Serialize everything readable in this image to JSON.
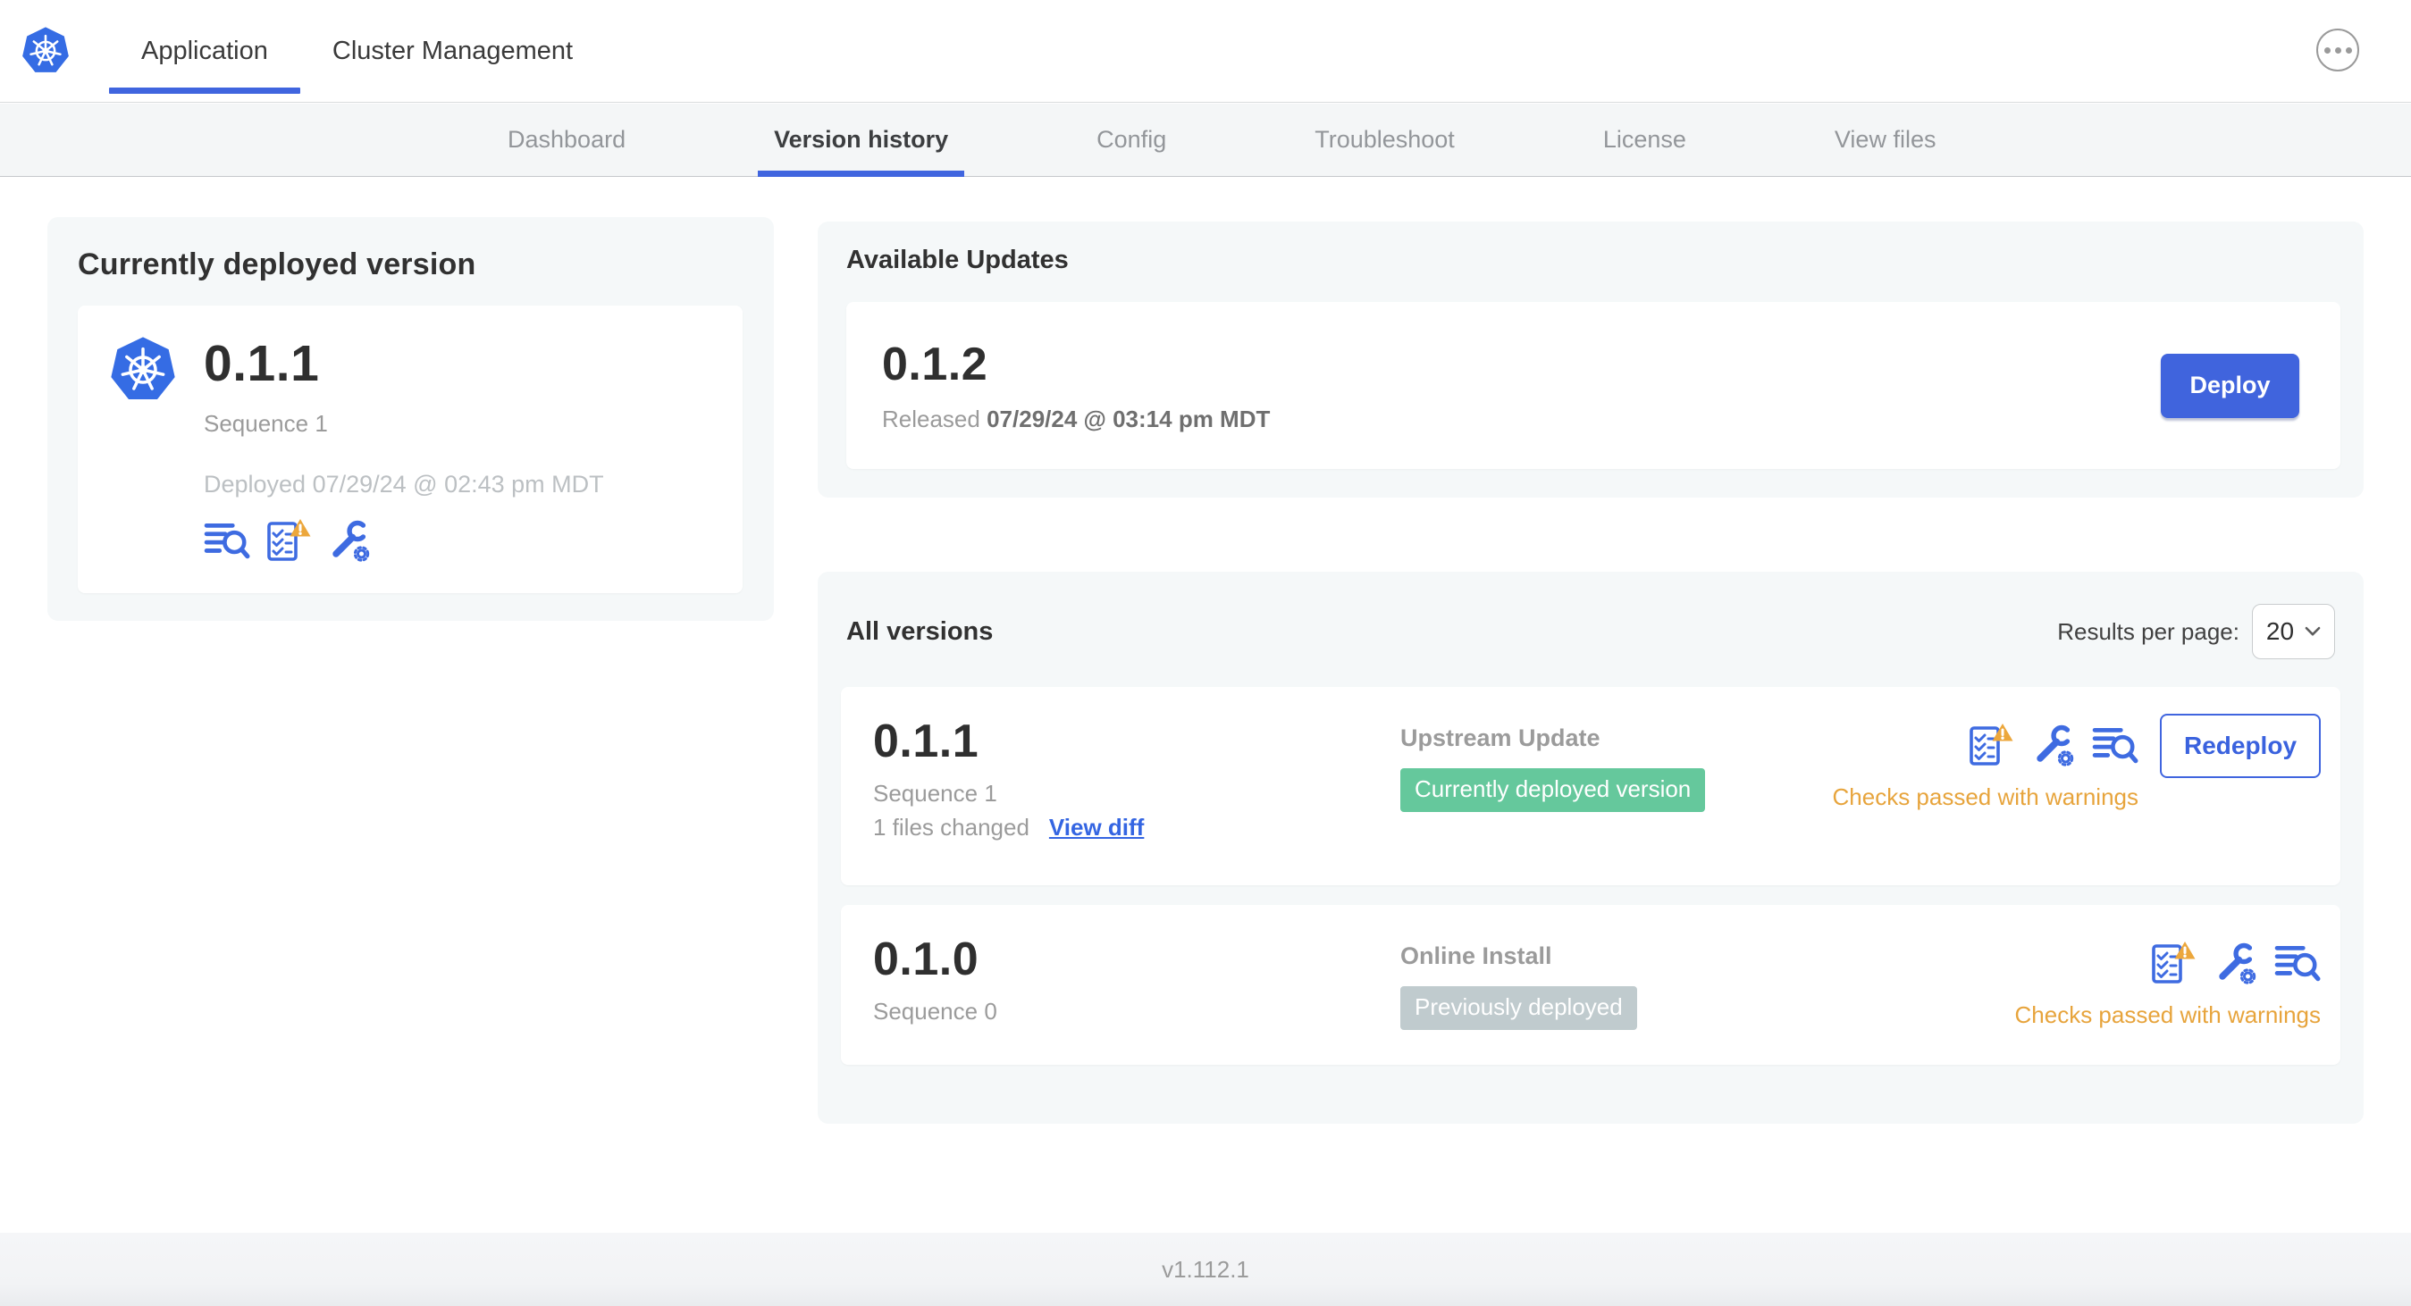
{
  "header": {
    "tabs": [
      {
        "label": "Application",
        "active": true
      },
      {
        "label": "Cluster Management",
        "active": false
      }
    ]
  },
  "nav": {
    "tabs": [
      "Dashboard",
      "Version history",
      "Config",
      "Troubleshoot",
      "License",
      "View files"
    ],
    "active_tab": "Version history"
  },
  "deployed_card": {
    "title": "Currently deployed version",
    "version": "0.1.1",
    "sequence": "Sequence 1",
    "deployed_at": "Deployed 07/29/24 @ 02:43 pm MDT"
  },
  "available_updates": {
    "title": "Available Updates",
    "version": "0.1.2",
    "released_label": "Released",
    "released_at": "07/29/24 @ 03:14 pm MDT",
    "deploy_label": "Deploy"
  },
  "all_versions": {
    "title": "All versions",
    "results_per_page_label": "Results per page:",
    "results_per_page_value": "20",
    "rows": [
      {
        "version": "0.1.1",
        "sequence": "Sequence 1",
        "files_changed": "1 files changed",
        "view_diff_label": "View diff",
        "source": "Upstream Update",
        "badge": "Currently deployed version",
        "badge_type": "green",
        "checks_text": "Checks passed with warnings",
        "action_label": "Redeploy"
      },
      {
        "version": "0.1.0",
        "sequence": "Sequence 0",
        "source": "Online Install",
        "badge": "Previously deployed",
        "badge_type": "gray",
        "checks_text": "Checks passed with warnings"
      }
    ]
  },
  "footer": {
    "app_version": "v1.112.1"
  },
  "icons": {
    "logo": "kubernetes-wheel",
    "more": "ellipsis-in-circle",
    "logs": "text-lines-with-magnifier",
    "preflight": "checklist-with-warning-triangle",
    "config": "wrench-with-gear",
    "chevron": "chevron-down"
  },
  "colors": {
    "accent_blue": "#4065df",
    "logo_blue": "#356ce4",
    "icon_blue": "#3e6be1",
    "success_green": "#65c89c",
    "muted_badge_gray": "#c0cbce",
    "warning_orange": "#e7a43c",
    "text_dark": "#323232",
    "text_gray": "#9b9b9b",
    "card_bg": "#f5f8f9"
  }
}
